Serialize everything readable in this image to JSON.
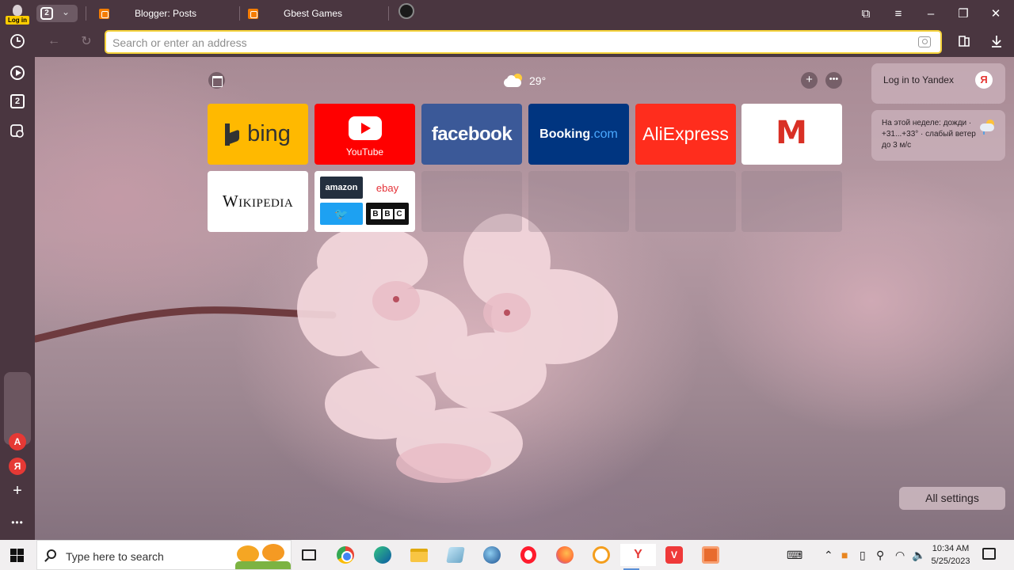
{
  "browser": {
    "login_label": "Log in",
    "tab_count": "2",
    "tabs": [
      {
        "title": "Blogger: Posts"
      },
      {
        "title": "Gbest Games"
      }
    ],
    "address_bar": {
      "placeholder": "Search or enter an address",
      "value": ""
    },
    "accent_color": "#f5d23b"
  },
  "sidebar": {
    "items": [
      {
        "icon": "history-icon"
      },
      {
        "icon": "video-play-icon"
      },
      {
        "icon": "tab-count-icon",
        "label": "2"
      },
      {
        "icon": "screenshot-icon"
      }
    ],
    "bottom_apps": [
      {
        "icon": "translate-icon",
        "label": "A"
      },
      {
        "icon": "yandex-icon",
        "label": "Я"
      },
      {
        "icon": "add-icon",
        "label": "+"
      }
    ],
    "more_label": "•••"
  },
  "newtab": {
    "weather": {
      "temperature": "29°"
    },
    "tiles": [
      {
        "name": "bing",
        "label": "bing"
      },
      {
        "name": "youtube",
        "label": "YouTube"
      },
      {
        "name": "facebook",
        "label": "facebook"
      },
      {
        "name": "booking",
        "label": "Booking",
        "label_suffix": ".com"
      },
      {
        "name": "aliexpress",
        "label": "AliExpress"
      },
      {
        "name": "gmail",
        "label": "M"
      },
      {
        "name": "wikipedia",
        "label": "Wikipedia"
      },
      {
        "name": "folder",
        "items": [
          "amazon",
          "ebay",
          "twitter",
          "BBC"
        ]
      }
    ],
    "widgets": {
      "login": {
        "text": "Log in to Yandex",
        "badge": "Я"
      },
      "weather_forecast": {
        "text": "На этой неделе: дожди · +31...+33° · слабый ветер до 3 м/с"
      }
    },
    "all_settings_label": "All settings"
  },
  "taskbar": {
    "search_placeholder": "Type here to search",
    "apps": [
      "task-view",
      "chrome",
      "edge",
      "file-explorer",
      "glass-app",
      "globe-app",
      "opera",
      "firefox",
      "brave",
      "yandex-browser",
      "vivaldi",
      "app-orange"
    ],
    "active_app": "yandex-browser",
    "clock": {
      "time": "10:34 AM",
      "date": "5/25/2023"
    }
  }
}
